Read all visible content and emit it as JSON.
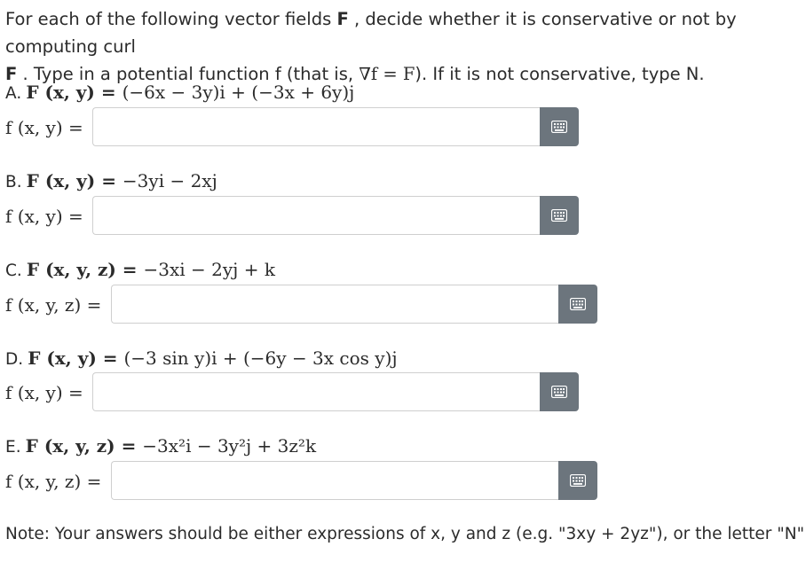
{
  "intro": {
    "text_1": "For each of the following vector fields ",
    "F_bold": "F",
    "text_2": " , decide whether it is conservative or not by computing curl ",
    "F_bold_2": "F",
    "text_3": " . Type in a potential function f (that is, ",
    "grad_expr": "∇f = F",
    "text_4": "). If it is not conservative, type N."
  },
  "questions": [
    {
      "letter": "A.",
      "field_lhs": "F (x, y) = ",
      "field_rhs": "(−6x − 3y)i + (−3x + 6y)j",
      "answer_lhs": "f (x, y) =",
      "answer_value": ""
    },
    {
      "letter": "B.",
      "field_lhs": "F (x, y) = ",
      "field_rhs": "−3yi − 2xj",
      "answer_lhs": "f (x, y) =",
      "answer_value": ""
    },
    {
      "letter": "C.",
      "field_lhs": "F (x, y, z) = ",
      "field_rhs": "−3xi − 2yj + k",
      "answer_lhs": "f (x, y, z) =",
      "answer_value": ""
    },
    {
      "letter": "D.",
      "field_lhs": "F (x, y) = ",
      "field_rhs": "(−3 sin y)i + (−6y − 3x cos y)j",
      "answer_lhs": "f (x, y) =",
      "answer_value": ""
    },
    {
      "letter": "E.",
      "field_lhs": "F (x, y, z) = ",
      "field_rhs": "−3x²i − 3y²j + 3z²k",
      "answer_lhs": "f (x, y, z) =",
      "answer_value": ""
    }
  ],
  "note": "Note: Your answers should be either expressions of x, y and z (e.g. \"3xy + 2yz\"), or the letter \"N\"",
  "colors": {
    "keyboard_button": "#6c757d",
    "field_border": "#cfcfcf",
    "text": "#2b2b2b"
  },
  "icons": {
    "keyboard": "keyboard-icon"
  }
}
